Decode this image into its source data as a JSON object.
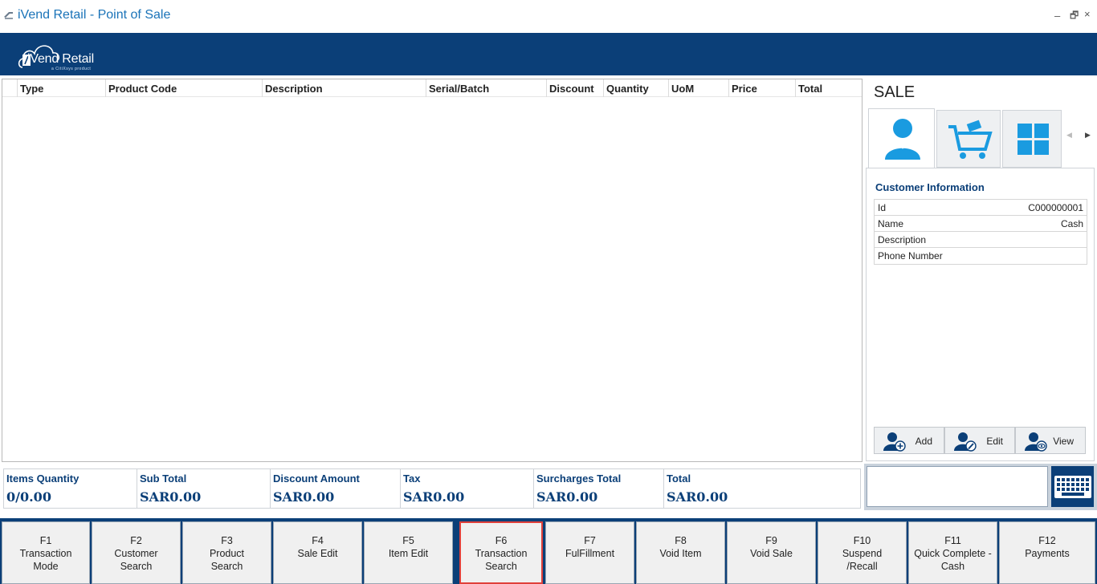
{
  "window": {
    "title": "iVend Retail - Point of Sale",
    "min_glyph": "–",
    "restore_glyph": "🗗",
    "close_glyph": "×"
  },
  "banner": {
    "logo_text": "iVend Retail",
    "logo_sub": "a CitiXsys product",
    "logo_i": "i"
  },
  "grid": {
    "columns": [
      "Type",
      "Product Code",
      "Description",
      "Serial/Batch",
      "Discount",
      "Quantity",
      "UoM",
      "Price",
      "Total"
    ],
    "rows": []
  },
  "sale_panel": {
    "title": "SALE",
    "tabs": [
      {
        "name": "customer",
        "icon": "customer-icon",
        "active": true
      },
      {
        "name": "cart",
        "icon": "cart-icon",
        "active": false
      },
      {
        "name": "apps",
        "icon": "grid-icon",
        "active": false
      }
    ],
    "customer_heading": "Customer Information",
    "customer_fields": [
      {
        "label": "Id",
        "value": "C000000001"
      },
      {
        "label": "Name",
        "value": "Cash"
      },
      {
        "label": "Description",
        "value": ""
      },
      {
        "label": "Phone Number",
        "value": ""
      }
    ],
    "buttons": {
      "add": "Add",
      "edit": "Edit",
      "view": "View"
    }
  },
  "totals": [
    {
      "label": "Items Quantity",
      "value": "0/0.00"
    },
    {
      "label": "Sub Total",
      "value": "SAR0.00"
    },
    {
      "label": "Discount Amount",
      "value": "SAR0.00"
    },
    {
      "label": "Tax",
      "value": "SAR0.00"
    },
    {
      "label": "Surcharges Total",
      "value": "SAR0.00"
    },
    {
      "label": "Total",
      "value": "SAR0.00"
    }
  ],
  "scan": {
    "value": ""
  },
  "function_keys": [
    {
      "key": "F1",
      "label": "Transaction\nMode"
    },
    {
      "key": "F2",
      "label": "Customer\nSearch"
    },
    {
      "key": "F3",
      "label": "Product\nSearch"
    },
    {
      "key": "F4",
      "label": "Sale Edit"
    },
    {
      "key": "F5",
      "label": "Item Edit"
    },
    {
      "key": "F6",
      "label": "Transaction\nSearch"
    },
    {
      "key": "F7",
      "label": "FulFillment"
    },
    {
      "key": "F8",
      "label": "Void Item"
    },
    {
      "key": "F9",
      "label": "Void Sale"
    },
    {
      "key": "F10",
      "label": "Suspend\n/Recall"
    },
    {
      "key": "F11",
      "label": "Quick Complete -\nCash"
    },
    {
      "key": "F12",
      "label": "Payments"
    }
  ],
  "colors": {
    "brand": "#0b3f78",
    "accent": "#1a9be0",
    "highlight": "#e0403a"
  }
}
